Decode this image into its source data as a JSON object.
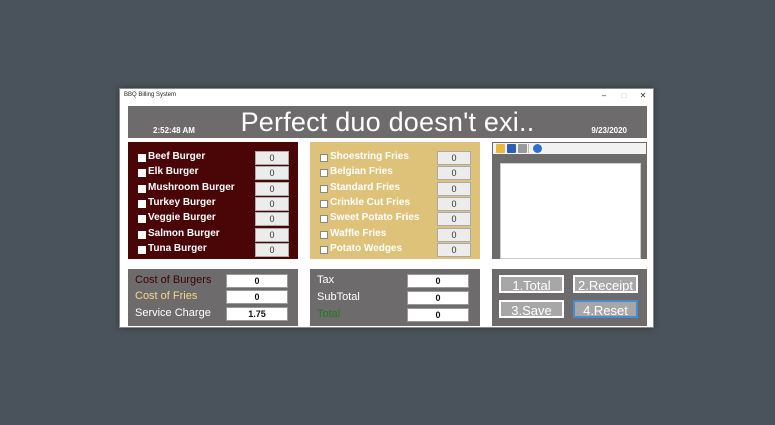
{
  "window": {
    "title": "BBQ Billing System",
    "min": "–",
    "max": "□",
    "close": "✕"
  },
  "header": {
    "time": "2:52:48 AM",
    "headline": "Perfect duo doesn't exi..",
    "date": "9/23/2020"
  },
  "burgers": [
    {
      "label": "Beef Burger",
      "qty": "0"
    },
    {
      "label": "Elk Burger",
      "qty": "0"
    },
    {
      "label": "Mushroom Burger",
      "qty": "0"
    },
    {
      "label": "Turkey Burger",
      "qty": "0"
    },
    {
      "label": "Veggie Burger",
      "qty": "0"
    },
    {
      "label": "Salmon Burger",
      "qty": "0"
    },
    {
      "label": "Tuna Burger",
      "qty": "0"
    }
  ],
  "fries": [
    {
      "label": "Shoestring Fries",
      "qty": "0"
    },
    {
      "label": "Belgian Fries",
      "qty": "0"
    },
    {
      "label": "Standard Fries",
      "qty": "0"
    },
    {
      "label": "Crinkle Cut Fries",
      "qty": "0"
    },
    {
      "label": "Sweet Potato Fries",
      "qty": "0"
    },
    {
      "label": "Waffle Fries",
      "qty": "0"
    },
    {
      "label": "Potato Wedges",
      "qty": "0"
    }
  ],
  "costs": {
    "burgers_label": "Cost of Burgers",
    "burgers_value": "0",
    "fries_label": "Cost of Fries",
    "fries_value": "0",
    "service_label": "Service Charge",
    "service_value": "1.75"
  },
  "totals": {
    "tax_label": "Tax",
    "tax_value": "0",
    "subtotal_label": "SubTotal",
    "subtotal_value": "0",
    "total_label": "Total",
    "total_value": "0"
  },
  "buttons": {
    "total": "1.Total",
    "receipt": "2.Receipt",
    "save": "3.Save",
    "reset": "4.Reset"
  },
  "toolbar_icons": [
    "open-folder-icon",
    "save-icon",
    "print-icon",
    "help-icon"
  ],
  "colors": {
    "background": "#4a535b",
    "header": "#6e6b6c",
    "burger_panel": "#4a0506",
    "fries_panel": "#dfc27a",
    "cost_burgers_text": "#3a0404",
    "cost_fries_text": "#f0d98c",
    "total_text": "#1f7a1f",
    "button": "#a7a7a7",
    "active_border": "#4a8ad1"
  }
}
